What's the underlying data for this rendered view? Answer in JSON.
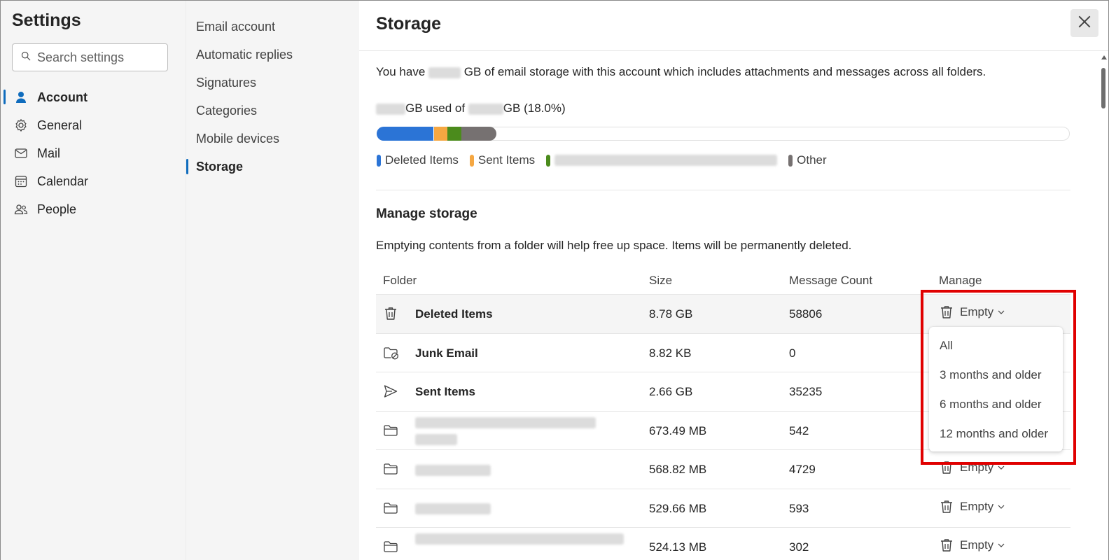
{
  "nav": {
    "title": "Settings",
    "search_placeholder": "Search settings",
    "items": [
      {
        "label": "Account",
        "icon": "person-icon"
      },
      {
        "label": "General",
        "icon": "gear-icon"
      },
      {
        "label": "Mail",
        "icon": "mail-icon"
      },
      {
        "label": "Calendar",
        "icon": "calendar-icon"
      },
      {
        "label": "People",
        "icon": "people-icon"
      }
    ],
    "active": "Account"
  },
  "subnav": {
    "items": [
      "Email account",
      "Automatic replies",
      "Signatures",
      "Categories",
      "Mobile devices",
      "Storage"
    ],
    "active": "Storage"
  },
  "main": {
    "title": "Storage",
    "intro_pre": "You have",
    "intro_post": "GB of email storage with this account which includes attachments and messages across all folders.",
    "usage_mid": "GB used of",
    "usage_end": "GB",
    "usage_pct": "(18.0%)",
    "legend": [
      {
        "label": "Deleted Items",
        "color": "#2b74d6"
      },
      {
        "label": "Sent Items",
        "color": "#f5a742"
      },
      {
        "label": "",
        "color": "#4b8b1c"
      },
      {
        "label": "Other",
        "color": "#767171"
      }
    ],
    "manage_title": "Manage storage",
    "manage_desc": "Emptying contents from a folder will help free up space. Items will be permanently deleted.",
    "columns": {
      "folder": "Folder",
      "size": "Size",
      "count": "Message Count",
      "manage": "Manage"
    },
    "rows": [
      {
        "icon": "trash-icon",
        "name": "Deleted Items",
        "size": "8.78 GB",
        "count": "58806",
        "manage": "Empty"
      },
      {
        "icon": "junk-folder-icon",
        "name": "Junk Email",
        "size": "8.82 KB",
        "count": "0",
        "manage": ""
      },
      {
        "icon": "send-icon",
        "name": "Sent Items",
        "size": "2.66 GB",
        "count": "35235",
        "manage": ""
      },
      {
        "icon": "folder-icon",
        "name": "",
        "size": "673.49 MB",
        "count": "542",
        "manage": ""
      },
      {
        "icon": "folder-icon",
        "name": "",
        "size": "568.82 MB",
        "count": "4729",
        "manage": "Empty"
      },
      {
        "icon": "folder-icon",
        "name": "",
        "size": "529.66 MB",
        "count": "593",
        "manage": "Empty"
      },
      {
        "icon": "folder-icon",
        "name": "",
        "size": "524.13 MB",
        "count": "302",
        "manage": "Empty"
      }
    ],
    "dropdown": [
      "All",
      "3 months and older",
      "6 months and older",
      "12 months and older"
    ]
  },
  "colors": {
    "accent": "#0f6cbd",
    "highlight": "#e00000"
  }
}
